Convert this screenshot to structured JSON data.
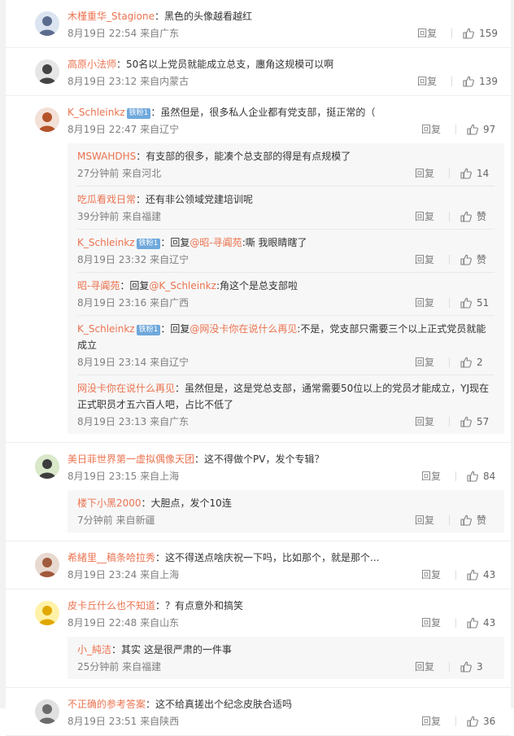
{
  "reply_label": "回复",
  "comments": [
    {
      "user": "木槿重华_Stagione",
      "text": "：黑色的头像越看越红",
      "time": "8月19日 22:54",
      "loc": "来自广东",
      "likes": "159",
      "avatar_icon": "avatar-anime-girl-icon",
      "replies": []
    },
    {
      "user": "高原小法师",
      "text": "：50名以上党员就能成立总支，廛角这规模可以啊",
      "time": "8月19日 23:12",
      "loc": "来自内蒙古",
      "likes": "139",
      "avatar_icon": "avatar-glasses-icon",
      "replies": []
    },
    {
      "user": "K_Schleinkz",
      "iron": "铁粉1",
      "text": "：虽然但是，很多私人企业都有党支部，挺正常的（",
      "time": "8月19日 22:47",
      "loc": "来自辽宁",
      "likes": "97",
      "avatar_icon": "avatar-redhair-icon",
      "replies": [
        {
          "user": "MSWAHDHS",
          "text": "：有支部的很多，能凑个总支部的得是有点规模了",
          "time": "27分钟前",
          "loc": "来自河北",
          "likes": "14"
        },
        {
          "user": "吃瓜看戏日常",
          "text": "：还有非公领域党建培训呢",
          "time": "39分钟前",
          "loc": "来自福建",
          "likes": "赞"
        },
        {
          "user": "K_Schleinkz",
          "iron": "铁粉1",
          "text": "：回复",
          "at": "@昭-寻阗苑",
          "text2": ":嘶 我眼睛瞎了",
          "time": "8月19日 23:32",
          "loc": "来自辽宁",
          "likes": "赞"
        },
        {
          "user": "昭-寻阗苑",
          "text": "：回复",
          "at": "@K_Schleinkz",
          "text2": ":角这个是总支部啦",
          "time": "8月19日 23:16",
          "loc": "来自广西",
          "likes": "51"
        },
        {
          "user": "K_Schleinkz",
          "iron": "铁粉1",
          "text": "：回复",
          "at": "@网没卡你在说什么再见",
          "text2": ":不是，党支部只需要三个以上正式党员就能成立",
          "time": "8月19日 23:14",
          "loc": "来自辽宁",
          "likes": "2"
        },
        {
          "user": "网没卡你在说什么再见",
          "text": "：虽然但是，这是党总支部，通常需要50位以上的党员才能成立，YJ现在正式职员才五六百人吧，占比不低了",
          "time": "8月19日 23:13",
          "loc": "来自广东",
          "likes": "57"
        }
      ]
    },
    {
      "user": "美日菲世界第一虚拟偶像天团",
      "text": "：这不得做个PV，发个专辑？",
      "time": "8月19日 23:15",
      "loc": "来自上海",
      "likes": "84",
      "avatar_icon": "avatar-cartoon-icon",
      "replies": [
        {
          "user": "楼下小黑2000",
          "text": "：大胆点，发个10连",
          "time": "7分钟前",
          "loc": "来自新疆",
          "likes": "赞"
        }
      ]
    },
    {
      "user": "希緒里__稿条哈拉秀",
      "text": "：这不得送点啥庆祝一下吗，比如那个，就是那个...",
      "time": "8月19日 23:24",
      "loc": "来自上海",
      "likes": "43",
      "avatar_icon": "avatar-group-icon",
      "replies": []
    },
    {
      "user": "皮卡丘什么也不知道",
      "text": "：？有点意外和搞笑",
      "time": "8月19日 22:48",
      "loc": "来自山东",
      "likes": "43",
      "avatar_icon": "avatar-pikachu-icon",
      "replies": [
        {
          "user": "小_純洁",
          "text": "：其实 这是很严肃的一件事",
          "time": "25分钟前",
          "loc": "来自福建",
          "likes": "3"
        }
      ]
    },
    {
      "user": "不正确的参考答案",
      "text": "：这不给真搓出个纪念皮肤合适吗",
      "time": "8月19日 23:51",
      "loc": "来自陕西",
      "likes": "36",
      "avatar_icon": "avatar-cat-icon",
      "replies": []
    }
  ]
}
